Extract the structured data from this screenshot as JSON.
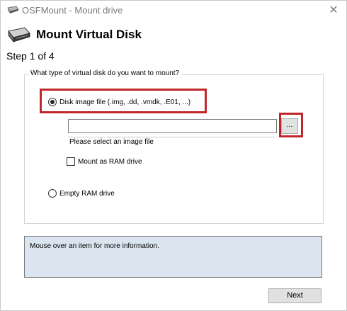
{
  "window": {
    "title": "OSFMount - Mount drive",
    "close_glyph": "✕",
    "app_icon": "drive-icon"
  },
  "header": {
    "title": "Mount Virtual Disk",
    "step": "Step 1 of 4",
    "icon": "hard-disk-icon"
  },
  "group": {
    "legend": "What type of virtual disk do you want to mount?"
  },
  "options": {
    "disk_image_label": "Disk image file (.img, .dd, .vmdk, .E01, ...)",
    "disk_image_selected": true,
    "file_value": "",
    "browse_label": "...",
    "hint": "Please select an image file",
    "ram_checkbox_label": "Mount as RAM drive",
    "ram_checkbox_checked": false,
    "empty_ram_label": "Empty RAM drive",
    "empty_ram_selected": false
  },
  "info": {
    "text": "Mouse over an item for more information."
  },
  "footer": {
    "next_label": "Next"
  },
  "colors": {
    "highlight": "#c0272d",
    "info_bg": "#dbe5f0"
  }
}
